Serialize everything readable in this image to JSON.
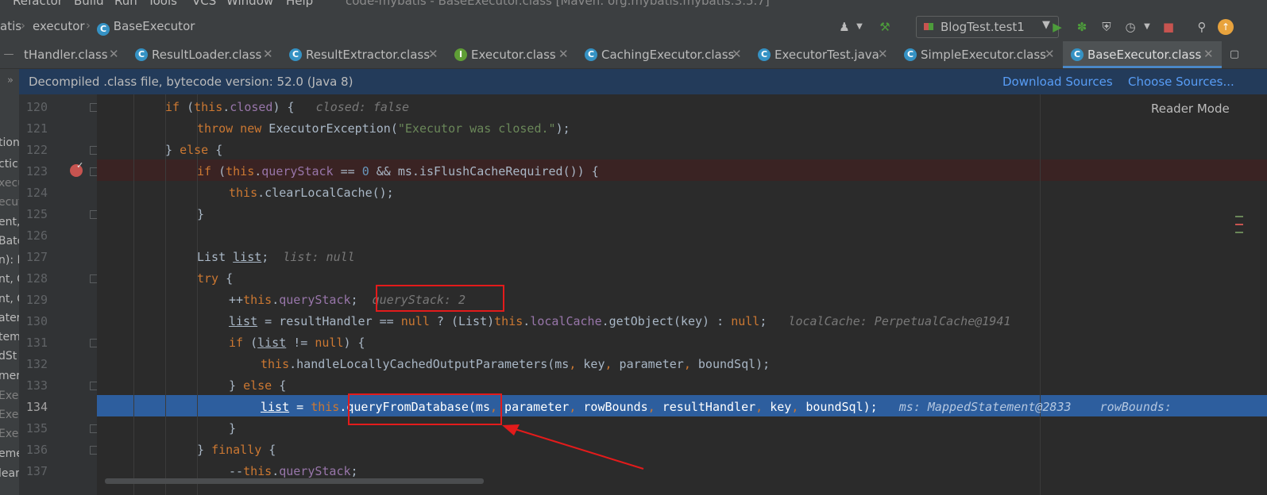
{
  "window": {
    "title": "code-mybatis - BaseExecutor.class [Maven: org.mybatis:mybatis:3.5.7]",
    "menu": [
      "Refactor",
      "Build",
      "Run",
      "Tools",
      "VCS",
      "Window",
      "Help"
    ]
  },
  "breadcrumb": {
    "items": [
      "atis",
      "executor",
      "BaseExecutor"
    ]
  },
  "toolbar": {
    "run_config": "BlogTest.test1",
    "icons": [
      "user-icon",
      "build-hammer-icon",
      "run-icon",
      "debug-icon",
      "coverage-icon",
      "profile-icon",
      "stop-icon",
      "search-icon",
      "update-icon"
    ]
  },
  "tabs": [
    {
      "label": "tHandler.class",
      "icon": "class-icon",
      "active": false
    },
    {
      "label": "ResultLoader.class",
      "icon": "class-icon",
      "active": false
    },
    {
      "label": "ResultExtractor.class",
      "icon": "class-icon",
      "active": false
    },
    {
      "label": "Executor.class",
      "icon": "interface-icon",
      "active": false
    },
    {
      "label": "CachingExecutor.class",
      "icon": "class-icon",
      "active": false
    },
    {
      "label": "ExecutorTest.java",
      "icon": "class-icon",
      "active": false
    },
    {
      "label": "SimpleExecutor.class",
      "icon": "class-icon",
      "active": false
    },
    {
      "label": "BaseExecutor.class",
      "icon": "class-icon",
      "active": true
    }
  ],
  "banner": {
    "text": "Decompiled .class file, bytecode version: 52.0 (Java 8)",
    "download_sources": "Download Sources",
    "choose_sources": "Choose Sources..."
  },
  "editor": {
    "reader_mode": "Reader Mode",
    "line_numbers": [
      "120",
      "121",
      "122",
      "123",
      "124",
      "125",
      "126",
      "127",
      "128",
      "129",
      "130",
      "131",
      "132",
      "133",
      "134",
      "135",
      "136",
      "137"
    ],
    "current_line": "134",
    "breakpoint_line": "123",
    "hints": {
      "closed": "closed: false",
      "list": "list: null",
      "query_stack": "queryStack: 2",
      "local_cache": "localCache: PerpetualCache@1941",
      "ms": "ms: MappedStatement@2833",
      "row_bounds": "rowBounds:"
    }
  },
  "left_panel_fragments": [
    "tion",
    "ctic",
    "xecu",
    "ecut",
    "ent,",
    "Batc",
    "n): I",
    "nt, C",
    "nt, C",
    "ater",
    "teme",
    "dSt",
    "mer",
    "Exe",
    "Exe",
    "Exe",
    "eme",
    "lear"
  ],
  "colors": {
    "annotation": "#e31b1b",
    "execution_line": "#2d5e9e",
    "breakpoint": "#c75450",
    "link": "#589df6"
  }
}
